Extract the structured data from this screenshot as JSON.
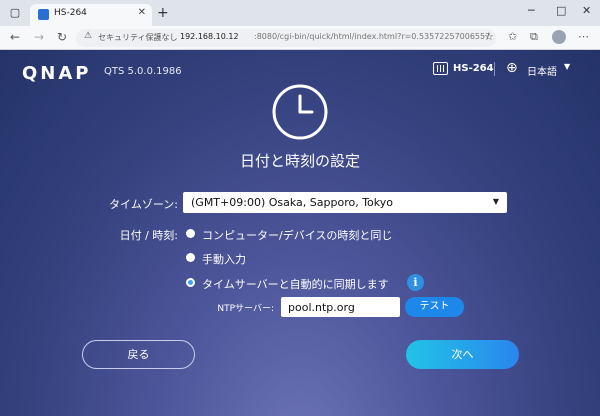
{
  "browser": {
    "tab_title": "HS-264",
    "tab_close": "✕",
    "new_tab": "+",
    "security_label": "セキュリティ保護なし",
    "url_host": "192.168.10.12",
    "url_path": ":8080/cgi-bin/quick/html/index.html?r=0.5357225700655739#advan..."
  },
  "header": {
    "logo": "QNAP",
    "os_version": "QTS 5.0.0.1986",
    "device_name": "HS-264",
    "language": "日本語"
  },
  "main": {
    "title": "日付と時刻の設定",
    "timezone_label": "タイムゾーン:",
    "timezone_value": "(GMT+09:00) Osaka, Sapporo, Tokyo",
    "datetime_label": "日付 / 時刻:",
    "options": [
      {
        "label": "コンピューター/デバイスの時刻と同じ",
        "selected": false
      },
      {
        "label": "手動入力",
        "selected": false
      },
      {
        "label": "タイムサーバーと自動的に同期します",
        "selected": true
      }
    ],
    "ntp_label": "NTPサーバー:",
    "ntp_value": "pool.ntp.org",
    "test_label": "テスト",
    "back_label": "戻る",
    "next_label": "次へ"
  },
  "colors": {
    "accent": "#1e88ea",
    "next_gradient_start": "#22c3e6",
    "background": "#323f7a"
  }
}
